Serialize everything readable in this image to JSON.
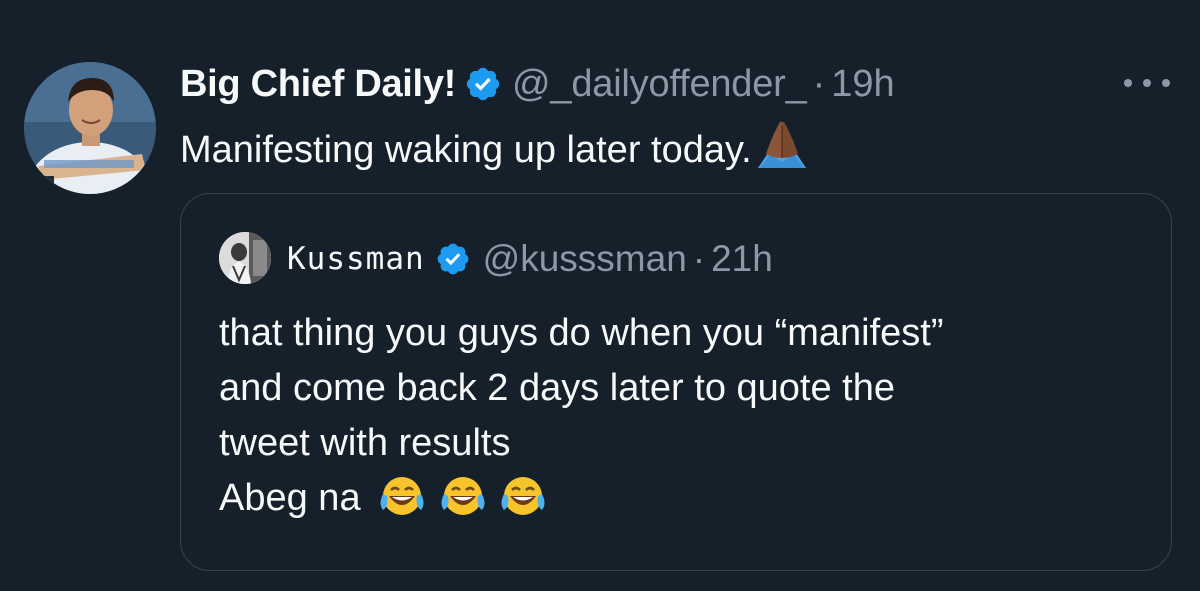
{
  "tweet": {
    "display_name": "Big Chief Daily!",
    "handle": "@_dailyoffender_",
    "separator": "·",
    "time": "19h",
    "text": "Manifesting waking up later today.",
    "text_emoji": "folded-hands-dark-skin",
    "verified_icon": "verified-badge-icon",
    "more_icon": "more-options-icon"
  },
  "quoted": {
    "display_name": "Kussman",
    "handle": "@kusssman",
    "separator": "·",
    "time": "21h",
    "lines": [
      "that thing you guys do when you “manifest”",
      "and come back 2 days later to quote the",
      "tweet with results",
      "Abeg na"
    ],
    "trailing_emoji": [
      "face-with-tears-of-joy",
      "face-with-tears-of-joy",
      "face-with-tears-of-joy"
    ]
  },
  "colors": {
    "background": "#15202b",
    "primary_text": "#f7f9f9",
    "secondary_text": "#8b98a5",
    "border": "#38444d",
    "verified_blue": "#1d9bf0"
  }
}
